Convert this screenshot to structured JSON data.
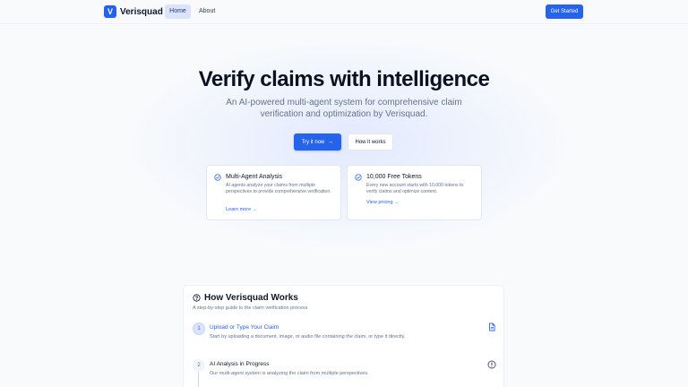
{
  "header": {
    "logo_letter": "V",
    "brand": "Verisquad",
    "nav": [
      {
        "label": "Home",
        "active": true
      },
      {
        "label": "About",
        "active": false
      }
    ],
    "cta": "Get Started"
  },
  "hero": {
    "title": "Verify claims with intelligence",
    "subtitle": "An AI-powered multi-agent system for comprehensive claim verification and optimization by Verisquad.",
    "primary_button": "Try it now",
    "primary_icon": "arrow-right-icon",
    "secondary_button": "How it works"
  },
  "features": [
    {
      "icon": "check-circle-icon",
      "title": "Multi-Agent Analysis",
      "description": "AI agents analyze your claims from multiple perspectives to provide comprehensive verification.",
      "link": "Learn more →"
    },
    {
      "icon": "check-circle-icon",
      "title": "10,000 Free Tokens",
      "description": "Every new account starts with 10,000 tokens to verify claims and optimize content.",
      "link": "View pricing →"
    }
  ],
  "how_it_works": {
    "icon": "help-circle-icon",
    "title": "How Verisquad Works",
    "subtitle": "A step-by-step guide to the claim verification process",
    "steps": [
      {
        "number": "1",
        "title": "Upload or Type Your Claim",
        "description": "Start by uploading a document, image, or audio file containing the claim, or type it directly.",
        "icon": "document-icon",
        "active": true
      },
      {
        "number": "2",
        "title": "AI Analysis in Progress",
        "description": "Our multi-agent system is analyzing the claim from multiple perspectives.",
        "icon": "info-circle-icon",
        "active": false
      }
    ]
  },
  "colors": {
    "accent": "#2563eb",
    "background": "#f8fafc",
    "nav_active": "#dbe4fb"
  }
}
